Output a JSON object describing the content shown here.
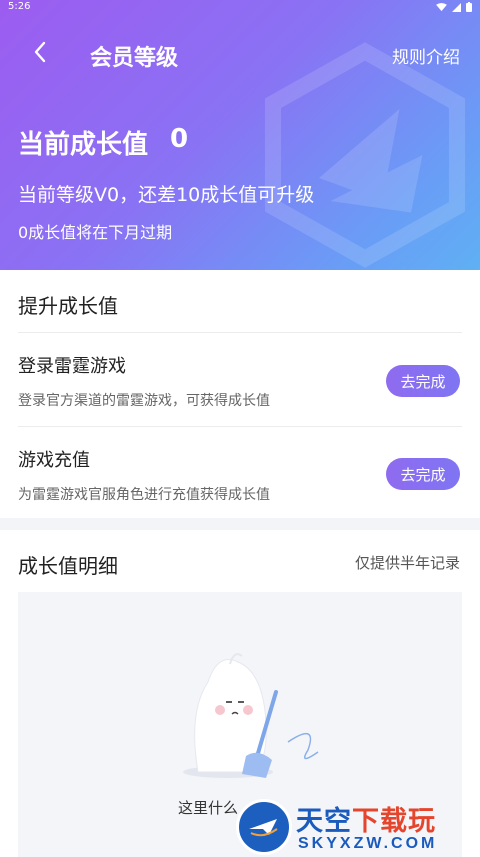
{
  "status_bar": {
    "time": "5:26"
  },
  "nav": {
    "title": "会员等级",
    "rule_link": "规则介绍"
  },
  "hero": {
    "growth_label": "当前成长值",
    "growth_value": "0",
    "level_line": "当前等级V0，还差10成长值可升级",
    "expire_line": "0成长值将在下月过期"
  },
  "tasks": {
    "section_title": "提升成长值",
    "items": [
      {
        "title": "登录雷霆游戏",
        "desc": "登录官方渠道的雷霆游戏，可获得成长值",
        "button": "去完成"
      },
      {
        "title": "游戏充值",
        "desc": "为雷霆游戏官服角色进行充值获得成长值",
        "button": "去完成"
      }
    ]
  },
  "detail": {
    "section_title": "成长值明细",
    "note": "仅提供半年记录",
    "empty_text": "这里什么"
  },
  "watermark": {
    "title_part1": "天空",
    "title_part2": "下载玩",
    "url": "SKYXZW.COM"
  }
}
